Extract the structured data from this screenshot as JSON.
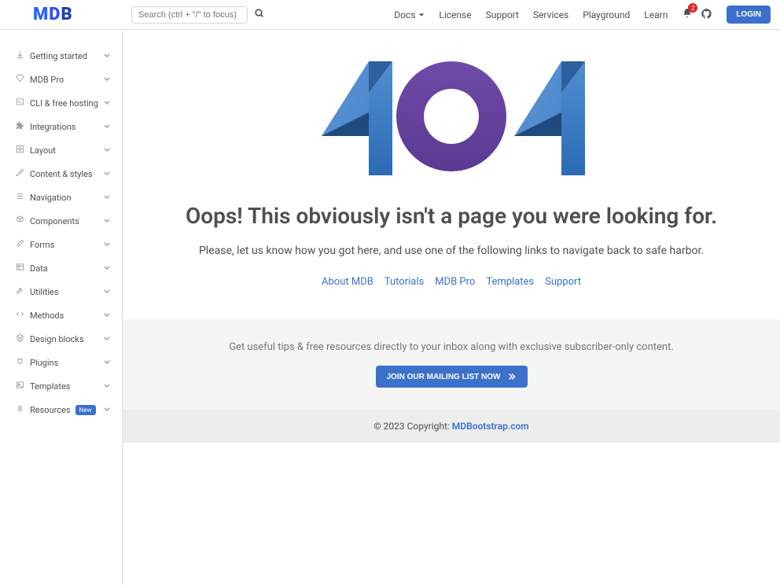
{
  "header": {
    "logo": {
      "m": "M",
      "d": "D",
      "b": "B"
    },
    "search": {
      "placeholder": "Search (ctrl + \"/\" to focus)"
    },
    "nav": {
      "docs": "Docs",
      "license": "License",
      "support": "Support",
      "services": "Services",
      "playground": "Playground",
      "learn": "Learn"
    },
    "bell_badge": "2",
    "login": "LOGIN"
  },
  "sidebar": {
    "items": [
      {
        "label": "Getting started",
        "icon": "download"
      },
      {
        "label": "MDB Pro",
        "icon": "gem"
      },
      {
        "label": "CLI & free hosting",
        "icon": "terminal"
      },
      {
        "label": "Integrations",
        "icon": "puzzle"
      },
      {
        "label": "Layout",
        "icon": "grid"
      },
      {
        "label": "Content & styles",
        "icon": "brush"
      },
      {
        "label": "Navigation",
        "icon": "menu"
      },
      {
        "label": "Components",
        "icon": "cubes"
      },
      {
        "label": "Forms",
        "icon": "edit"
      },
      {
        "label": "Data",
        "icon": "table"
      },
      {
        "label": "Utilities",
        "icon": "wrench"
      },
      {
        "label": "Methods",
        "icon": "code"
      },
      {
        "label": "Design blocks",
        "icon": "layers"
      },
      {
        "label": "Plugins",
        "icon": "plug"
      },
      {
        "label": "Templates",
        "icon": "image"
      },
      {
        "label": "Resources",
        "icon": "tools",
        "badge": "New"
      }
    ]
  },
  "error": {
    "title": "Oops! This obviously isn't a page you were looking for.",
    "text": "Please, let us know how you got here, and use one of the following links to navigate back to safe harbor.",
    "links": {
      "about": "About MDB",
      "tutorials": "Tutorials",
      "mdbpro": "MDB Pro",
      "templates": "Templates",
      "support": "Support"
    }
  },
  "cta": {
    "text": "Get useful tips & free resources directly to your inbox along with exclusive subscriber-only content.",
    "button": "JOIN OUR MAILING LIST NOW"
  },
  "footer": {
    "copyright": "© 2023 Copyright: ",
    "link": "MDBootstrap.com"
  }
}
